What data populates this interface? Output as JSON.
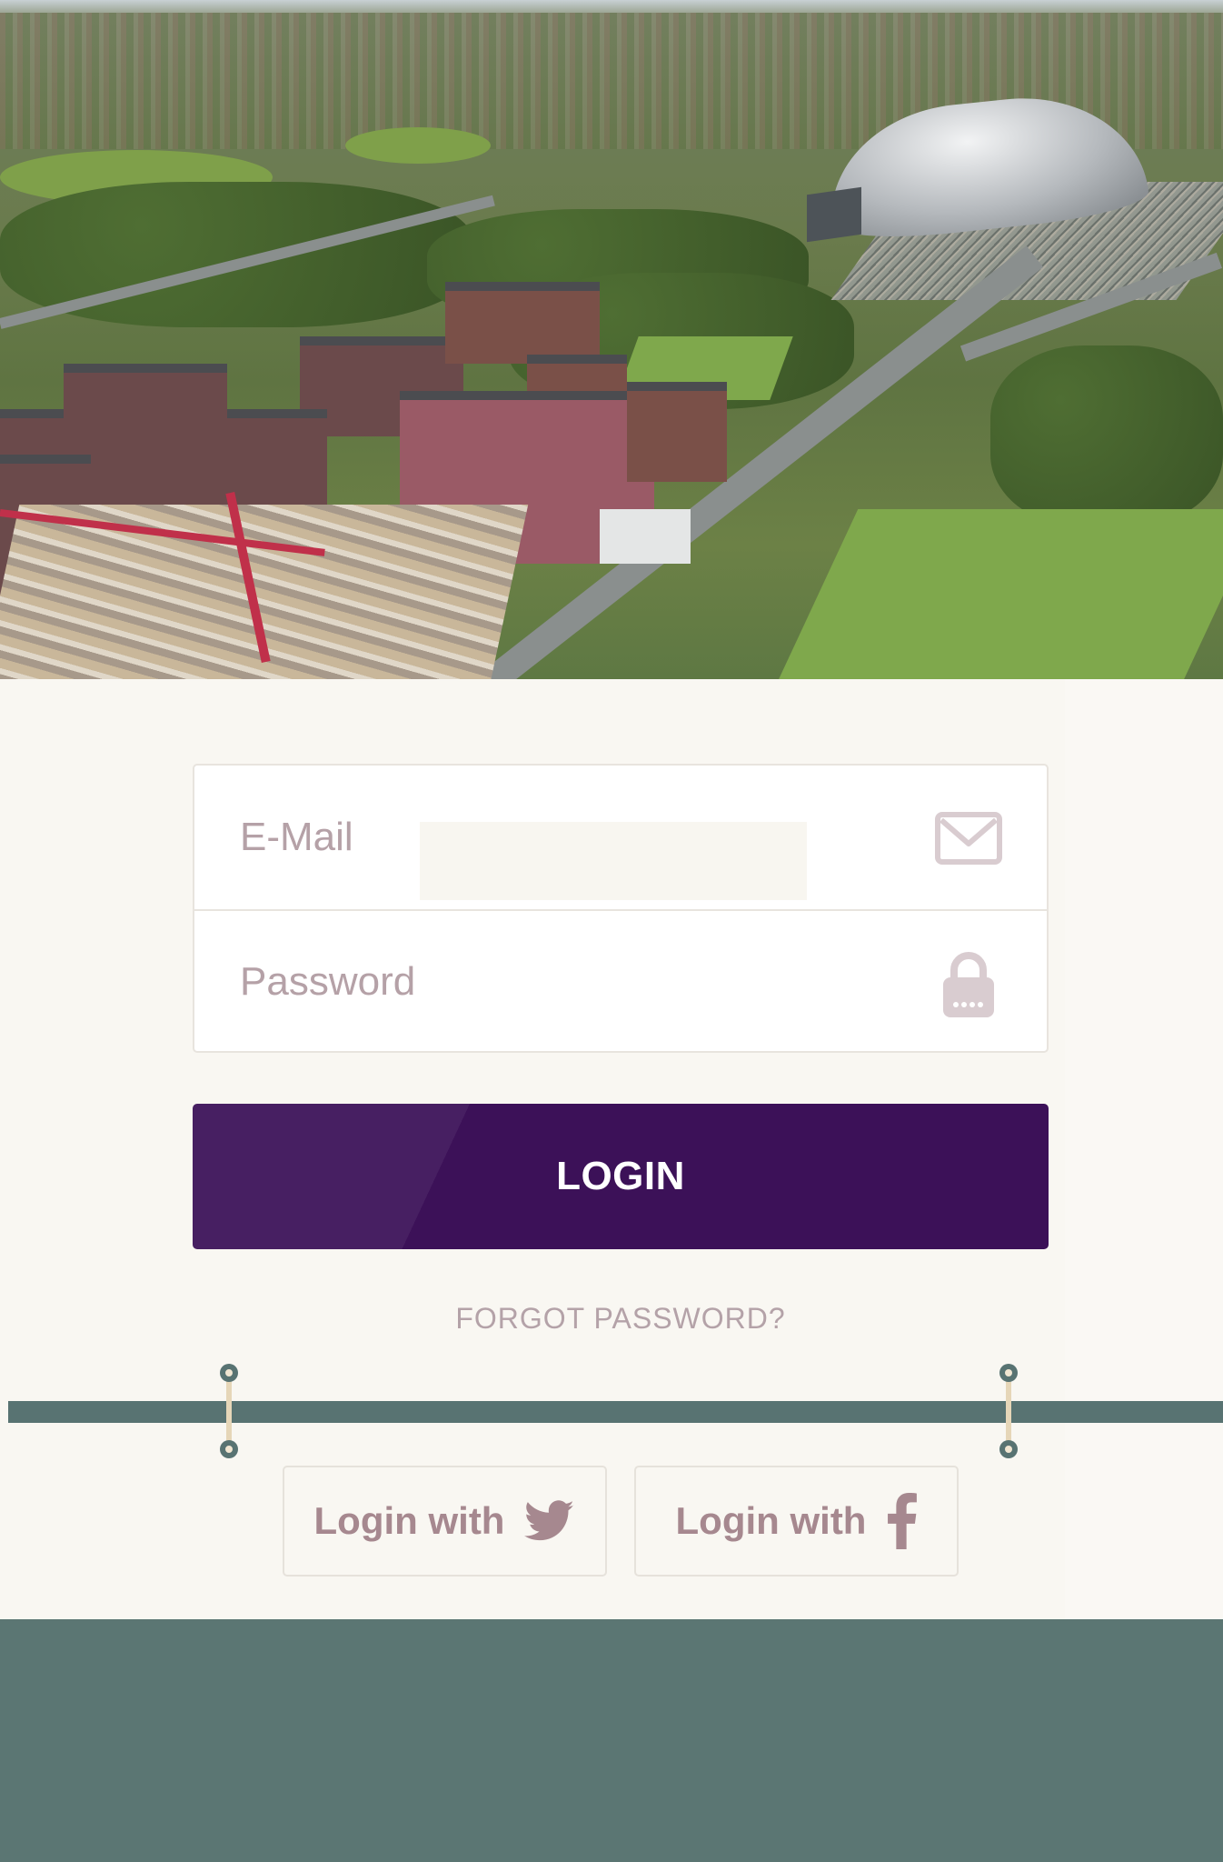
{
  "form": {
    "email_placeholder": "E-Mail",
    "password_placeholder": "Password",
    "login_label": "LOGIN",
    "forgot_label": "FORGOT PASSWORD?"
  },
  "social": {
    "twitter_label": "Login with",
    "facebook_label": "Login with"
  },
  "icons": {
    "email": "envelope-icon",
    "password": "padlock-icon",
    "twitter": "twitter-bird-icon",
    "facebook": "facebook-f-icon"
  },
  "colors": {
    "primary_button": "#3c1158",
    "accent_teal": "#587372",
    "panel_background": "#f9f7f2",
    "icon_muted": "#d9ccd0",
    "text_muted": "#b4a2a8"
  }
}
